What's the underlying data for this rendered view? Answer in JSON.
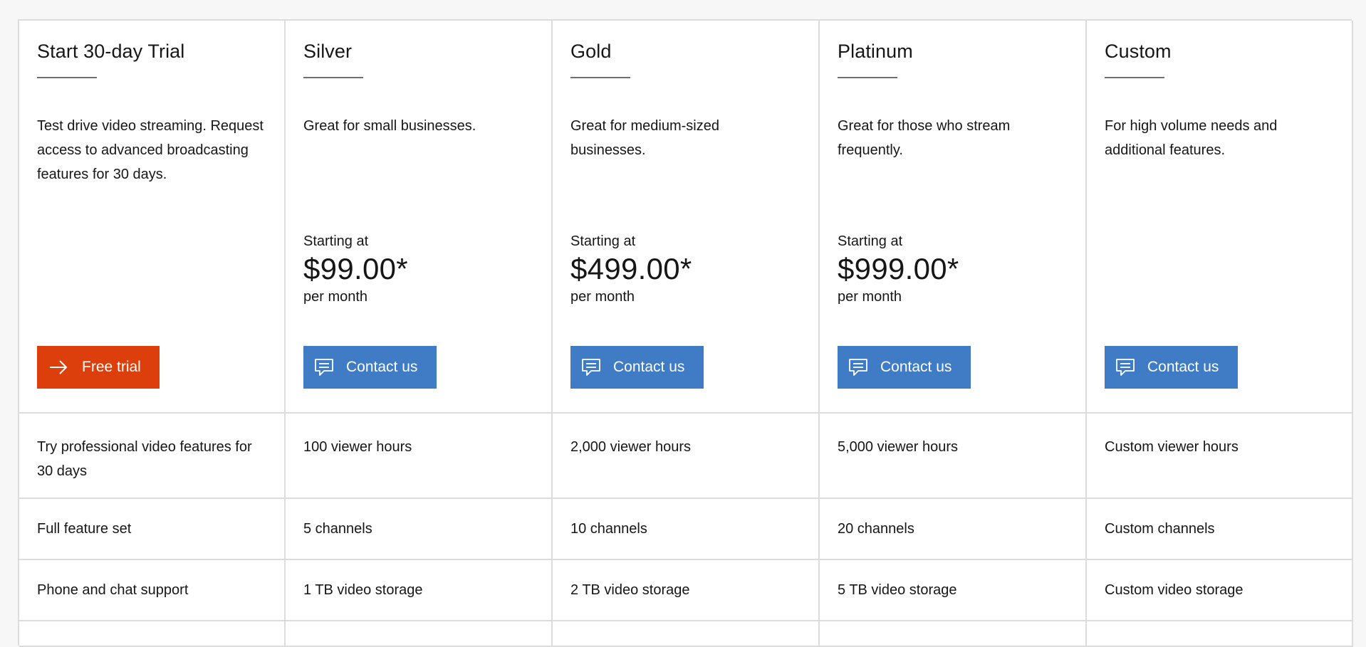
{
  "plans": [
    {
      "title": "Start 30-day Trial",
      "description": "Test drive video streaming. Request access to advanced broadcasting features for 30 days.",
      "cta_label": "Free trial",
      "cta_icon": "arrow-right-icon",
      "cta_color": "#dd3f0c"
    },
    {
      "title": "Silver",
      "description": "Great for small businesses.",
      "starting_at": "Starting at",
      "price": "$99.00*",
      "period": "per month",
      "cta_label": "Contact us",
      "cta_icon": "chat-icon",
      "cta_color": "#3f7cc5"
    },
    {
      "title": "Gold",
      "description": "Great for medium-sized businesses.",
      "starting_at": "Starting at",
      "price": "$499.00*",
      "period": "per month",
      "cta_label": "Contact us",
      "cta_icon": "chat-icon",
      "cta_color": "#3f7cc5"
    },
    {
      "title": "Platinum",
      "description": "Great for those who stream frequently.",
      "starting_at": "Starting at",
      "price": "$999.00*",
      "period": "per month",
      "cta_label": "Contact us",
      "cta_icon": "chat-icon",
      "cta_color": "#3f7cc5"
    },
    {
      "title": "Custom",
      "description": "For high volume needs and additional features.",
      "cta_label": "Contact us",
      "cta_icon": "chat-icon",
      "cta_color": "#3f7cc5"
    }
  ],
  "features": [
    [
      "Try professional video features for 30 days",
      "100 viewer hours",
      "2,000 viewer hours",
      "5,000 viewer hours",
      "Custom viewer hours"
    ],
    [
      "Full feature set",
      "5 channels",
      "10 channels",
      "20 channels",
      "Custom channels"
    ],
    [
      "Phone and chat support",
      "1 TB video storage",
      "2 TB video storage",
      "5 TB video storage",
      "Custom video storage"
    ]
  ]
}
